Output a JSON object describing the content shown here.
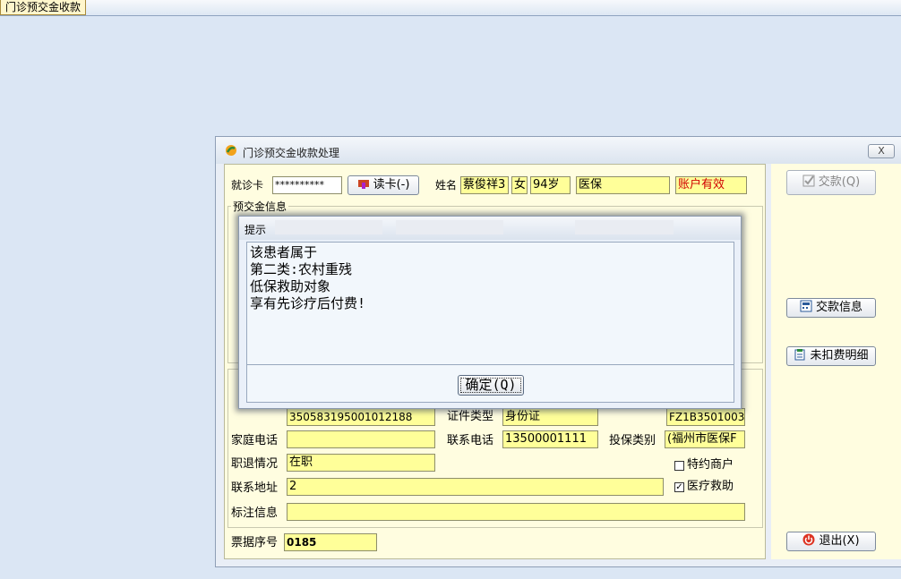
{
  "top_tab": "门诊预交金收款",
  "window": {
    "title": "门诊预交金收款处理",
    "close_label": "X"
  },
  "header": {
    "card_label": "就诊卡",
    "card_value": "**********",
    "read_card_label": "读卡(-)",
    "name_label": "姓名",
    "name_value": "蔡俊祥3",
    "gender": "女",
    "age": "94岁",
    "insurance": "医保",
    "account_status": "账户有效"
  },
  "prepay_group": {
    "title": "预交金信息"
  },
  "patient_group": {
    "id_number_partial": "350583195001012188",
    "id_type_label": "证件类型",
    "id_type_value": "身份证",
    "case_no_partial": "FZ1B3501003",
    "home_phone_label": "家庭电话",
    "home_phone_value": "",
    "contact_phone_label": "联系电话",
    "contact_phone_value": "13500001111",
    "ins_type_label": "投保类别",
    "ins_type_value": "(福州市医保F",
    "job_status_label": "职退情况",
    "job_status_value": "在职",
    "special_merchant_label": "特约商户",
    "address_label": "联系地址",
    "address_value": "2",
    "medical_aid_label": "医疗救助",
    "note_label": "标注信息",
    "note_value": ""
  },
  "receipt": {
    "label": "票据序号",
    "value": "0185"
  },
  "side_buttons": {
    "pay": "交款(Q)",
    "pay_info": "交款信息",
    "unpaid_detail": "未扣费明细",
    "exit": "退出(X)"
  },
  "dialog": {
    "title": "提示",
    "lines": [
      "该患者属于",
      "第二类:农村重残",
      "低保救助对象",
      "享有先诊疗后付费!"
    ],
    "ok_label": "确定(Q)"
  },
  "colors": {
    "field_bg": "#ffff99",
    "panel_bg": "#fffde0",
    "status_red": "#d00000",
    "desktop_bg": "#dbe6f4"
  }
}
